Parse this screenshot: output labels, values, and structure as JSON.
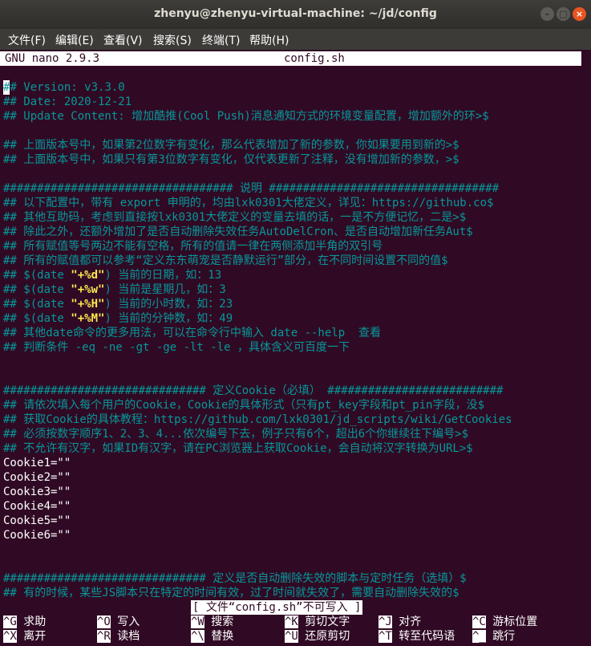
{
  "window": {
    "title": "zhenyu@zhenyu-virtual-machine: ~/jd/config",
    "buttons": {
      "minimize": "–",
      "maximize": "□",
      "close": "×"
    }
  },
  "menubar": [
    "文件(F)",
    "编辑(E)",
    "查看(V)",
    "搜索(S)",
    "终端(T)",
    "帮助(H)"
  ],
  "nano": {
    "version": "GNU nano 2.9.3",
    "filename": "config.sh",
    "status": "[ 文件“config.sh”不可写入 ]"
  },
  "lines": {
    "l1": "# Version: v3.3.0",
    "l2": "## Date: 2020-12-21",
    "l3": "## Update Content: 增加酷推(Cool Push)消息通知方式的环境变量配置，增加额外的环>$",
    "l5": "## 上面版本号中，如果第2位数字有变化，那么代表增加了新的参数，你如果要用到新的>$",
    "l6": "## 上面版本号中，如果只有第3位数字有变化，仅代表更新了注释，没有增加新的参数，>$",
    "l8": "################################## 说明 ##################################",
    "l9": "## 以下配置中，带有 export 申明的，均由lxk0301大佬定义，详见：https://github.co$",
    "l10": "## 其他互助码，考虑到直接按lxk0301大佬定义的变量去填的话，一是不方便记忆，二是>$",
    "l11": "## 除此之外，还额外增加了是否自动删除失效任务AutoDelCron、是否自动增加新任务Aut$",
    "l12": "## 所有赋值等号两边不能有空格，所有的值请一律在两侧添加半角的双引号",
    "l13": "## 所有的赋值都可以参考“定义东东萌宠是否静默运行”部分，在不同时间设置不同的值$",
    "l14a": "## $(date ",
    "l14b": "\"+%d\"",
    "l14c": ") 当前的日期，如：13",
    "l15a": "## $(date ",
    "l15b": "\"+%w\"",
    "l15c": ") 当前是星期几，如：3",
    "l16a": "## $(date ",
    "l16b": "\"+%H\"",
    "l16c": ") 当前的小时数，如：23",
    "l17a": "## $(date ",
    "l17b": "\"+%M\"",
    "l17c": ") 当前的分钟数，如：49",
    "l18": "## 其他date命令的更多用法，可以在命令行中输入 date --help  查看",
    "l19": "## 判断条件 -eq -ne -gt -ge -lt -le ，具体含义可百度一下",
    "l22": "############################## 定义Cookie（必填） ##########################",
    "l23": "## 请依次填入每个用户的Cookie，Cookie的具体形式（只有pt_key字段和pt_pin字段，没$",
    "l24": "## 获取Cookie的具体教程：https://github.com/lxk0301/jd_scripts/wiki/GetCookies",
    "l25": "## 必须按数字顺序1、2、3、4...依次编号下去，例子只有6个，超出6个你继续往下编号>$",
    "l26": "## 不允许有汉字，如果ID有汉字，请在PC浏览器上获取Cookie，会自动将汉字转换为URL>$",
    "c1": "Cookie1=\"\"",
    "c2": "Cookie2=\"\"",
    "c3": "Cookie3=\"\"",
    "c4": "Cookie4=\"\"",
    "c5": "Cookie5=\"\"",
    "c6": "Cookie6=\"\"",
    "l35": "############################## 定义是否自动删除失效的脚本与定时任务（选填）$",
    "l36": "## 有的时候，某些JS脚本只在特定的时间有效，过了时间就失效了，需要自动删除失效的$"
  },
  "shortcuts": {
    "r1": [
      {
        "key": "^G",
        "label": "求助"
      },
      {
        "key": "^O",
        "label": "写入"
      },
      {
        "key": "^W",
        "label": "搜索"
      },
      {
        "key": "^K",
        "label": "剪切文字"
      },
      {
        "key": "^J",
        "label": "对齐"
      },
      {
        "key": "^C",
        "label": "游标位置"
      }
    ],
    "r2": [
      {
        "key": "^X",
        "label": "离开"
      },
      {
        "key": "^R",
        "label": "读档"
      },
      {
        "key": "^\\",
        "label": "替换"
      },
      {
        "key": "^U",
        "label": "还原剪切"
      },
      {
        "key": "^T",
        "label": "转至代码语"
      },
      {
        "key": "^_",
        "label": "跳行"
      }
    ]
  },
  "colors": {
    "terminal_bg": "#300a24",
    "comment": "#06989a",
    "string": "#fce94f",
    "accent": "#e95420"
  }
}
